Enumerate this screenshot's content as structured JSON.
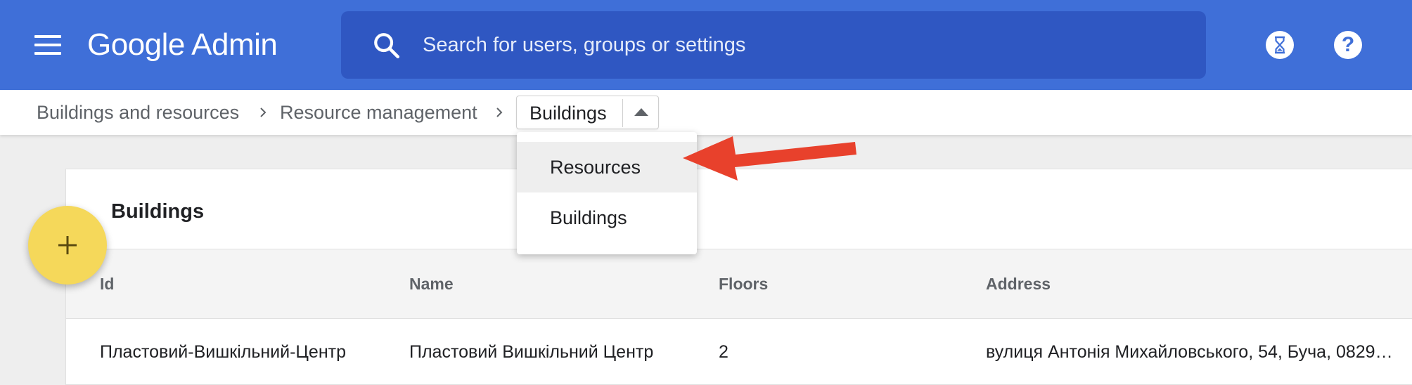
{
  "app": {
    "title": "Google Admin"
  },
  "header": {
    "search_placeholder": "Search for users, groups or settings",
    "icons": [
      "menu-icon",
      "search-icon",
      "hourglass-icon",
      "help-icon"
    ],
    "help_glyph": "?"
  },
  "breadcrumb": {
    "items": [
      "Buildings and resources",
      "Resource management"
    ],
    "current": "Buildings"
  },
  "dropdown": {
    "options": [
      "Resources",
      "Buildings"
    ],
    "highlighted": "Resources"
  },
  "card": {
    "title": "Buildings",
    "columns": [
      "Id",
      "Name",
      "Floors",
      "Address"
    ],
    "rows": [
      {
        "id": "Пластовий-Вишкільний-Центр",
        "name": "Пластовий Вишкільний Центр",
        "floors": "2",
        "address": "вулиця Антонія Михайловського, 54, Буча, 0829…"
      }
    ]
  },
  "fab": {
    "glyph": "+"
  },
  "colors": {
    "header": "#3f6fd8",
    "search": "#2f57c2",
    "fab": "#f5d85a",
    "annotation": "#e8412c"
  }
}
